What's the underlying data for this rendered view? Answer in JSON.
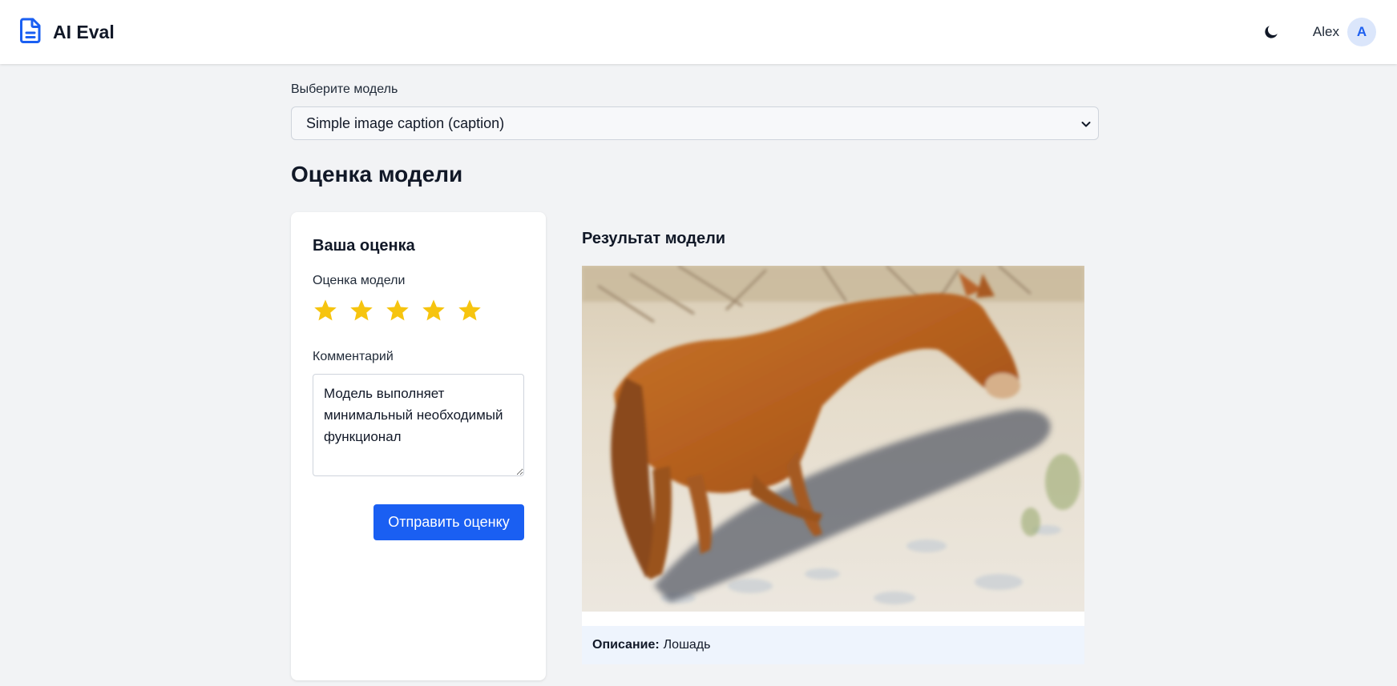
{
  "header": {
    "app_title": "AI Eval",
    "logo_icon": "document-icon",
    "theme_icon": "moon-icon",
    "user_name": "Alex",
    "avatar_initial": "A",
    "accent_color": "#1a5ff2"
  },
  "model_selector": {
    "label": "Выберите модель",
    "selected": "Simple image caption (caption)"
  },
  "page_title": "Оценка модели",
  "rating_card": {
    "title": "Ваша оценка",
    "rating_label": "Оценка модели",
    "rating": 5,
    "max_rating": 5,
    "star_color": "#f6c40f",
    "comment_label": "Комментарий",
    "comment_value": "Модель выполняет минимальный необходимый функционал",
    "submit_label": "Отправить оценку"
  },
  "result": {
    "title": "Результат модели",
    "image_subject": "horse",
    "caption_key": "Описание:",
    "caption_value": "Лошадь"
  }
}
